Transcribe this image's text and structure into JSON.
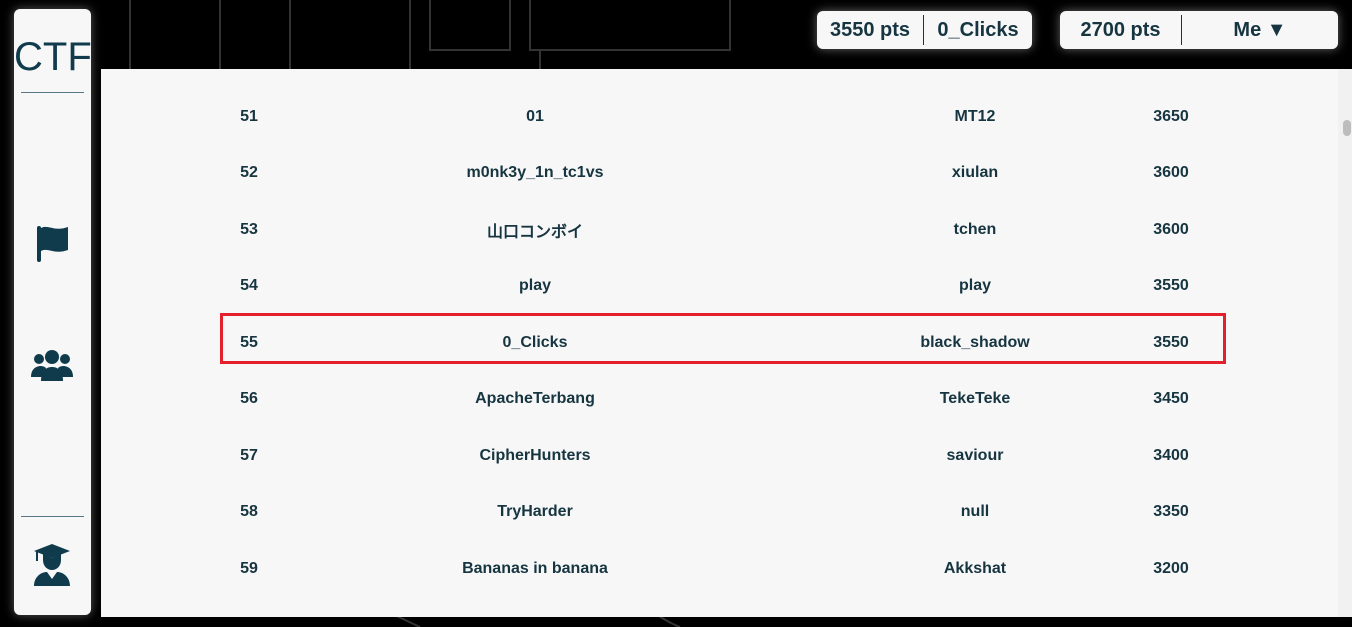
{
  "app": {
    "logo": "CTF"
  },
  "sidebar": {
    "items": [
      {
        "name": "challenges",
        "icon": "flag-icon"
      },
      {
        "name": "teams",
        "icon": "users-icon"
      },
      {
        "name": "profile",
        "icon": "graduate-icon"
      }
    ]
  },
  "header": {
    "team_pill": {
      "points": "3550 pts",
      "team": "0_Clicks"
    },
    "user_pill": {
      "points": "2700 pts",
      "menu": "Me ▼"
    }
  },
  "scoreboard": {
    "rows": [
      {
        "rank": "51",
        "team": "01",
        "user": "MT12",
        "points": "3650"
      },
      {
        "rank": "52",
        "team": "m0nk3y_1n_tc1vs",
        "user": "xiulan",
        "points": "3600"
      },
      {
        "rank": "53",
        "team": "山口コンボイ",
        "user": "tchen",
        "points": "3600"
      },
      {
        "rank": "54",
        "team": "play",
        "user": "play",
        "points": "3550"
      },
      {
        "rank": "55",
        "team": "0_Clicks",
        "user": "black_shadow",
        "points": "3550"
      },
      {
        "rank": "56",
        "team": "ApacheTerbang",
        "user": "TekeTeke",
        "points": "3450"
      },
      {
        "rank": "57",
        "team": "CipherHunters",
        "user": "saviour",
        "points": "3400"
      },
      {
        "rank": "58",
        "team": "TryHarder",
        "user": "null",
        "points": "3350"
      },
      {
        "rank": "59",
        "team": "Bananas in banana",
        "user": "Akkshat",
        "points": "3200"
      }
    ],
    "highlighted_rank": "55"
  },
  "colors": {
    "accent": "#0f3b4c",
    "highlight": "#e3202c",
    "panel": "#f7f7f7"
  }
}
